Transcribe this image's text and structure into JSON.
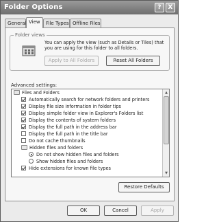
{
  "window": {
    "title": "Folder Options",
    "help_glyph": "?",
    "close_glyph": "X"
  },
  "tabs": [
    {
      "label": "General",
      "active": false
    },
    {
      "label": "View",
      "active": true
    },
    {
      "label": "File Types",
      "active": false
    },
    {
      "label": "Offline Files",
      "active": false
    }
  ],
  "folder_views": {
    "title": "Folder views",
    "icon": "folder-views-icon",
    "description": "You can apply the view (such as Details or Tiles) that you are using for this folder to all folders.",
    "apply_label": "Apply to All Folders",
    "reset_label": "Reset All Folders"
  },
  "advanced": {
    "label": "Advanced settings:",
    "items": [
      {
        "kind": "folder",
        "label": "Files and Folders",
        "indent": 0
      },
      {
        "kind": "check",
        "label": "Automatically search for network folders and printers",
        "checked": true,
        "indent": 1
      },
      {
        "kind": "check",
        "label": "Display file size information in folder tips",
        "checked": true,
        "indent": 1
      },
      {
        "kind": "check",
        "label": "Display simple folder view in Explorer's Folders list",
        "checked": true,
        "indent": 1
      },
      {
        "kind": "check",
        "label": "Display the contents of system folders",
        "checked": true,
        "indent": 1
      },
      {
        "kind": "check",
        "label": "Display the full path in the address bar",
        "checked": true,
        "indent": 1
      },
      {
        "kind": "check",
        "label": "Display the full path in the title bar",
        "checked": false,
        "indent": 1
      },
      {
        "kind": "check",
        "label": "Do not cache thumbnails",
        "checked": false,
        "indent": 1
      },
      {
        "kind": "folder",
        "label": "Hidden files and folders",
        "indent": 1
      },
      {
        "kind": "radio",
        "label": "Do not show hidden files and folders",
        "checked": true,
        "indent": 2
      },
      {
        "kind": "radio",
        "label": "Show hidden files and folders",
        "checked": false,
        "indent": 2
      },
      {
        "kind": "check",
        "label": "Hide extensions for known file types",
        "checked": true,
        "indent": 1
      }
    ],
    "restore_label": "Restore Defaults"
  },
  "footer": {
    "ok_label": "OK",
    "cancel_label": "Cancel",
    "apply_label": "Apply"
  }
}
